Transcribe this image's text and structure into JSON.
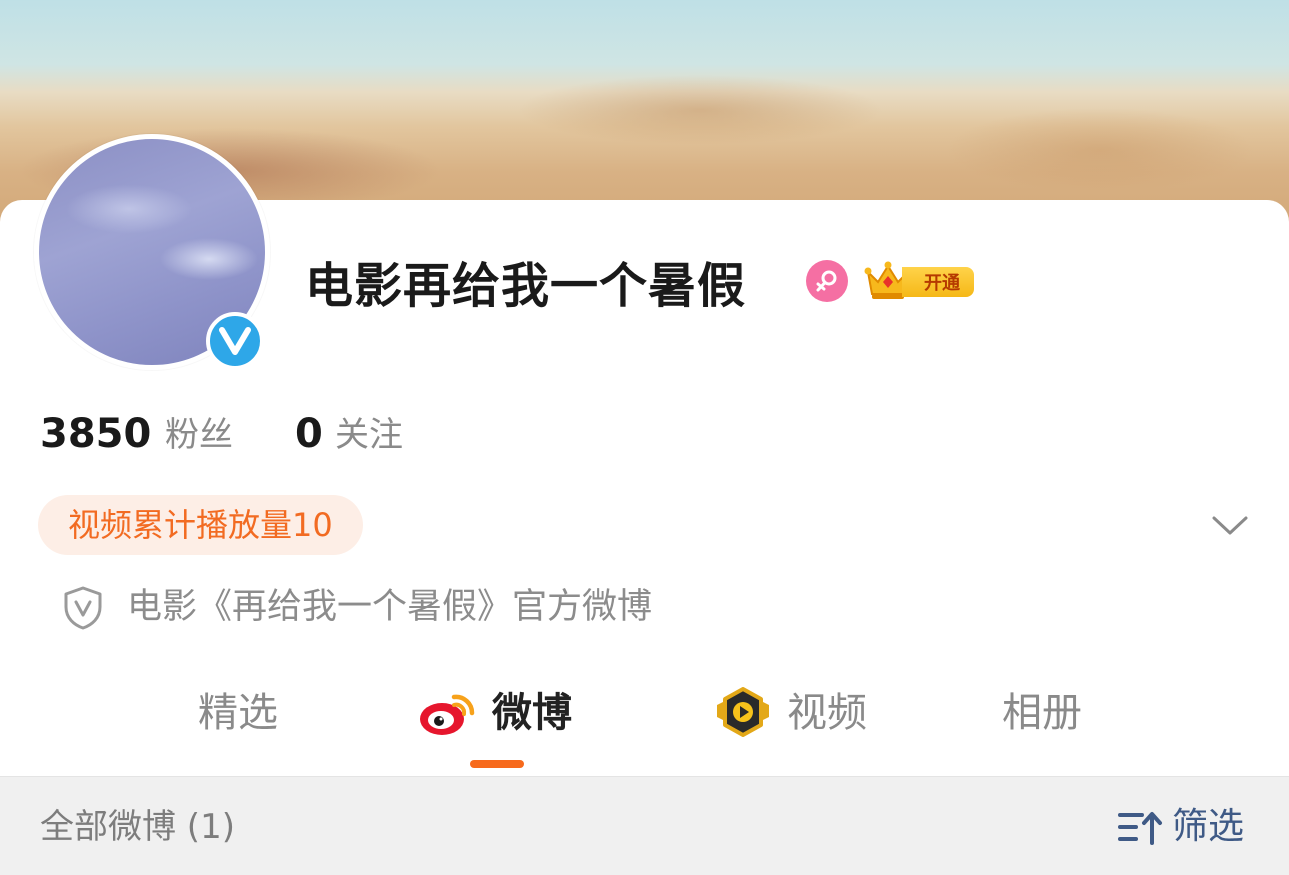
{
  "profile": {
    "name": "电影再给我一个暑假",
    "vip_label": "开通",
    "gender": "female"
  },
  "stats": {
    "followers_count": "3850",
    "followers_label": "粉丝",
    "following_count": "0",
    "following_label": "关注"
  },
  "badge": {
    "play_count_text": "视频累计播放量10"
  },
  "verification": {
    "description": "电影《再给我一个暑假》官方微博"
  },
  "tabs": [
    {
      "label": "精选",
      "icon": "none",
      "active": false
    },
    {
      "label": "微博",
      "icon": "weibo-logo-icon",
      "active": true
    },
    {
      "label": "视频",
      "icon": "video-play-icon",
      "active": false
    },
    {
      "label": "相册",
      "icon": "none",
      "active": false
    }
  ],
  "filter": {
    "all_posts_label": "全部微博 (1)",
    "filter_label": "筛选"
  },
  "colors": {
    "accent_orange": "#f76a1c",
    "verified_blue": "#2ea7e8",
    "gender_pink": "#f56fa3",
    "filter_blue": "#3f5a86"
  }
}
